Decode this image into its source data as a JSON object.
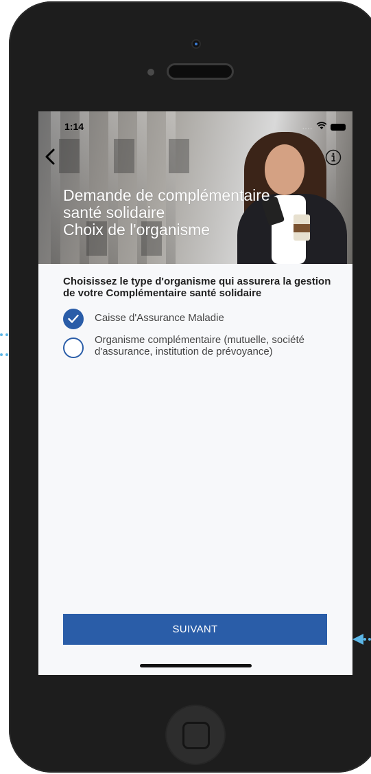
{
  "status_bar": {
    "time": "1:14",
    "signal": "....",
    "icons": [
      "wifi-icon",
      "battery-icon"
    ]
  },
  "header": {
    "back_icon": "chevron-left-icon",
    "info_icon": "info-circle-icon",
    "title_lines": [
      "Demande de complémentaire",
      "santé solidaire",
      "Choix de l'organisme"
    ]
  },
  "form": {
    "question": "Choisissez le type d'organisme qui assurera la gestion de votre Complémentaire santé solidaire",
    "options": [
      {
        "label": "Caisse d'Assurance Maladie",
        "selected": true
      },
      {
        "label": "Organisme complémentaire (mutuelle, société d'assurance, institution de prévoyance)",
        "selected": false
      }
    ]
  },
  "footer": {
    "submit_label": "SUIVANT"
  },
  "colors": {
    "accent": "#2a5da8",
    "pointer": "#5bb6e6",
    "device": "#1d1d1d"
  }
}
